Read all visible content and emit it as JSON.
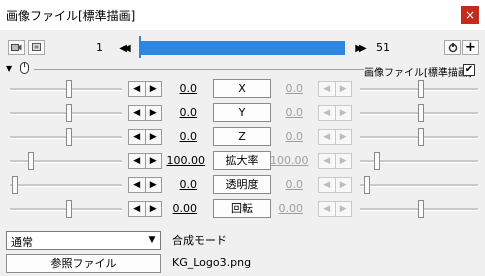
{
  "window": {
    "title": "画像ファイル[標準描画]",
    "close_glyph": "×"
  },
  "toolbar": {
    "start_frame": "1",
    "end_frame": "51"
  },
  "object": {
    "label": "画像ファイル[標準描画]",
    "enabled": true
  },
  "params": [
    {
      "name": "X",
      "left_value": "0.0",
      "right_value": "0.0"
    },
    {
      "name": "Y",
      "left_value": "0.0",
      "right_value": "0.0"
    },
    {
      "name": "Z",
      "left_value": "0.0",
      "right_value": "0.0"
    },
    {
      "name": "拡大率",
      "left_value": "100.00",
      "right_value": "100.00"
    },
    {
      "name": "透明度",
      "left_value": "0.0",
      "right_value": "0.0"
    },
    {
      "name": "回転",
      "left_value": "0.00",
      "right_value": "0.00"
    }
  ],
  "blend": {
    "selected": "通常",
    "label": "合成モード"
  },
  "file": {
    "button_label": "参照ファイル",
    "filename": "KG_Logo3.png"
  },
  "icons": {
    "prev_glyph": "◀◀",
    "next_glyph": "▶▶",
    "add_glyph": "+",
    "left_arrow": "◀",
    "right_arrow": "▶",
    "dropdown": "▼",
    "check": "✔"
  },
  "colors": {
    "accent": "#2f86e0",
    "close": "#c42b1c"
  }
}
